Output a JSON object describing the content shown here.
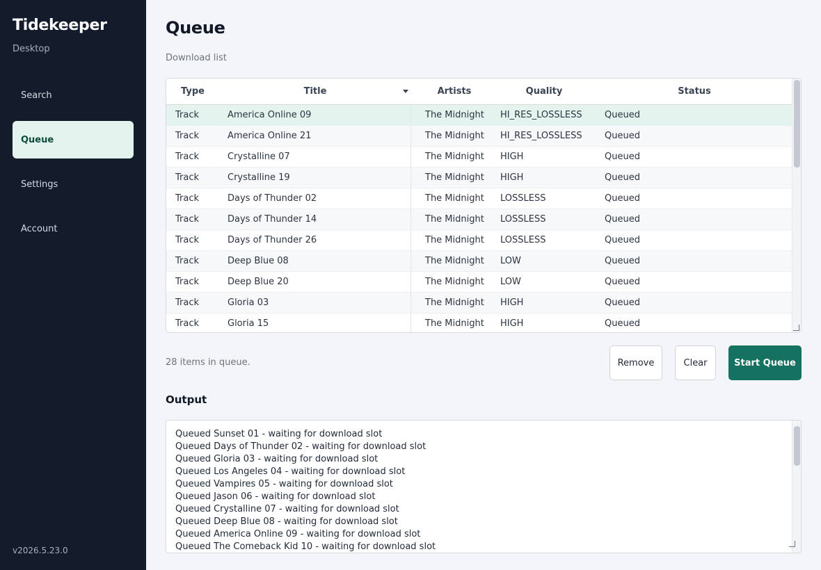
{
  "sidebar": {
    "brand": "Tidekeeper",
    "subtitle": "Desktop",
    "items": [
      {
        "label": "Search",
        "active": false
      },
      {
        "label": "Queue",
        "active": true
      },
      {
        "label": "Settings",
        "active": false
      },
      {
        "label": "Account",
        "active": false
      }
    ],
    "version": "v2026.5.23.0"
  },
  "main": {
    "title": "Queue",
    "subtitle": "Download list",
    "table": {
      "columns": [
        "Type",
        "Title",
        "Artists",
        "Quality",
        "Status"
      ],
      "sorted_column": "Title",
      "sort_icon": "caret-down-icon",
      "rows": [
        {
          "type": "Track",
          "title": "America Online 09",
          "artists": "The Midnight",
          "quality": "HI_RES_LOSSLESS",
          "status": "Queued",
          "selected": true
        },
        {
          "type": "Track",
          "title": "America Online 21",
          "artists": "The Midnight",
          "quality": "HI_RES_LOSSLESS",
          "status": "Queued"
        },
        {
          "type": "Track",
          "title": "Crystalline 07",
          "artists": "The Midnight",
          "quality": "HIGH",
          "status": "Queued"
        },
        {
          "type": "Track",
          "title": "Crystalline 19",
          "artists": "The Midnight",
          "quality": "HIGH",
          "status": "Queued"
        },
        {
          "type": "Track",
          "title": "Days of Thunder 02",
          "artists": "The Midnight",
          "quality": "LOSSLESS",
          "status": "Queued"
        },
        {
          "type": "Track",
          "title": "Days of Thunder 14",
          "artists": "The Midnight",
          "quality": "LOSSLESS",
          "status": "Queued"
        },
        {
          "type": "Track",
          "title": "Days of Thunder 26",
          "artists": "The Midnight",
          "quality": "LOSSLESS",
          "status": "Queued"
        },
        {
          "type": "Track",
          "title": "Deep Blue 08",
          "artists": "The Midnight",
          "quality": "LOW",
          "status": "Queued"
        },
        {
          "type": "Track",
          "title": "Deep Blue 20",
          "artists": "The Midnight",
          "quality": "LOW",
          "status": "Queued"
        },
        {
          "type": "Track",
          "title": "Gloria 03",
          "artists": "The Midnight",
          "quality": "HIGH",
          "status": "Queued"
        },
        {
          "type": "Track",
          "title": "Gloria 15",
          "artists": "The Midnight",
          "quality": "HIGH",
          "status": "Queued"
        }
      ]
    },
    "count_text": "28 items in queue.",
    "buttons": {
      "remove": "Remove",
      "clear": "Clear",
      "start": "Start Queue"
    },
    "output": {
      "title": "Output",
      "lines": [
        "Queued Sunset 01 - waiting for download slot",
        "Queued Days of Thunder 02 - waiting for download slot",
        "Queued Gloria 03 - waiting for download slot",
        "Queued Los Angeles 04 - waiting for download slot",
        "Queued Vampires 05 - waiting for download slot",
        "Queued Jason 06 - waiting for download slot",
        "Queued Crystalline 07 - waiting for download slot",
        "Queued Deep Blue 08 - waiting for download slot",
        "Queued America Online 09 - waiting for download slot",
        "Queued The Comeback Kid 10 - waiting for download slot"
      ]
    }
  },
  "colors": {
    "sidebar_bg": "#141b2a",
    "accent": "#157260",
    "selected_bg": "#e3f3ee",
    "page_bg": "#f3f5f8"
  }
}
